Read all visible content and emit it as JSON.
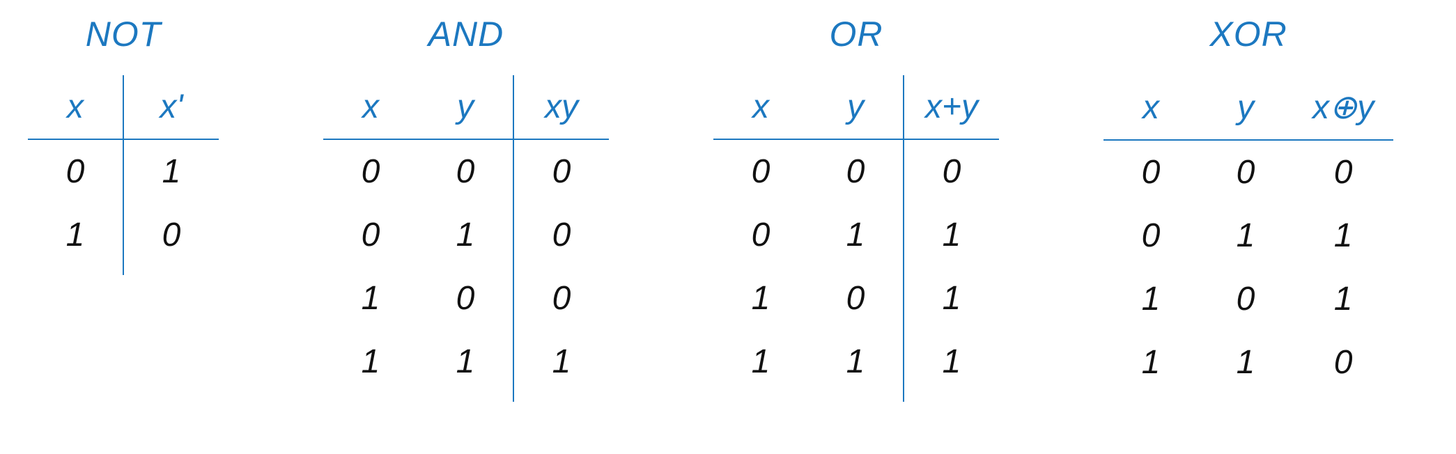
{
  "tables": {
    "not": {
      "title": "NOT",
      "headers": [
        "x",
        "x'"
      ],
      "rows": [
        [
          "0",
          "1"
        ],
        [
          "1",
          "0"
        ]
      ]
    },
    "and": {
      "title": "AND",
      "headers": [
        "x",
        "y",
        "xy"
      ],
      "rows": [
        [
          "0",
          "0",
          "0"
        ],
        [
          "0",
          "1",
          "0"
        ],
        [
          "1",
          "0",
          "0"
        ],
        [
          "1",
          "1",
          "1"
        ]
      ]
    },
    "or": {
      "title": "OR",
      "headers": [
        "x",
        "y",
        "x+y"
      ],
      "rows": [
        [
          "0",
          "0",
          "0"
        ],
        [
          "0",
          "1",
          "1"
        ],
        [
          "1",
          "0",
          "1"
        ],
        [
          "1",
          "1",
          "1"
        ]
      ]
    },
    "xor": {
      "title": "XOR",
      "headers": [
        "x",
        "y",
        "x⊕y"
      ],
      "rows": [
        [
          "0",
          "0",
          "0"
        ],
        [
          "0",
          "1",
          "1"
        ],
        [
          "1",
          "0",
          "1"
        ],
        [
          "1",
          "1",
          "0"
        ]
      ]
    }
  },
  "chart_data": [
    {
      "type": "table",
      "title": "NOT",
      "columns": [
        "x",
        "x'"
      ],
      "rows": [
        [
          0,
          1
        ],
        [
          1,
          0
        ]
      ]
    },
    {
      "type": "table",
      "title": "AND",
      "columns": [
        "x",
        "y",
        "xy"
      ],
      "rows": [
        [
          0,
          0,
          0
        ],
        [
          0,
          1,
          0
        ],
        [
          1,
          0,
          0
        ],
        [
          1,
          1,
          1
        ]
      ]
    },
    {
      "type": "table",
      "title": "OR",
      "columns": [
        "x",
        "y",
        "x+y"
      ],
      "rows": [
        [
          0,
          0,
          0
        ],
        [
          0,
          1,
          1
        ],
        [
          1,
          0,
          1
        ],
        [
          1,
          1,
          1
        ]
      ]
    },
    {
      "type": "table",
      "title": "XOR",
      "columns": [
        "x",
        "y",
        "x⊕y"
      ],
      "rows": [
        [
          0,
          0,
          0
        ],
        [
          0,
          1,
          1
        ],
        [
          1,
          0,
          1
        ],
        [
          1,
          1,
          0
        ]
      ]
    }
  ]
}
